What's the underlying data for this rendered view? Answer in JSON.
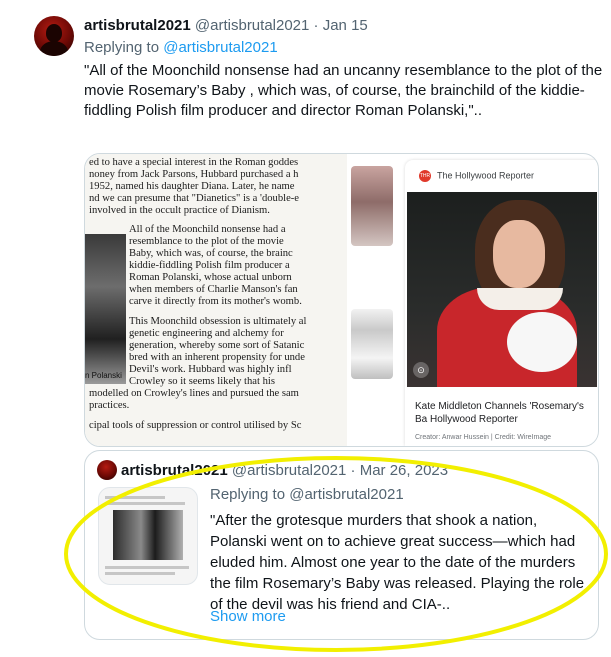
{
  "tweet": {
    "display_name": "artisbrutal2021",
    "handle": "@artisbrutal2021",
    "separator": "·",
    "date": "Jan 15",
    "replying_prefix": "Replying to",
    "replying_to": "@artisbrutal2021",
    "text": "\"All of the Moonchild nonsense had an uncanny resemblance to the plot of the movie Rosemary’s Baby , which was, of course, the brainchild of the kiddie-fiddling Polish film producer and director Roman Polanski,\".."
  },
  "media": {
    "scan_lines": [
      "ed to have a special interest in the Roman goddes",
      "noney from Jack Parsons, Hubbard purchased a h",
      "1952, named his daughter Diana. Later, he name",
      "nd we can presume that \"Dianetics\" is a 'double-e",
      "involved in the occult practice of Dianism.",
      "All of the Moonchild nonsense had a",
      "resemblance to the plot of the movie",
      "Baby, which was, of course, the brainc",
      "kiddie-fiddling Polish film producer a",
      "Roman Polanski, whose actual unborn",
      "when members of Charlie Manson's fan",
      "carve it directly from its mother's womb.",
      "This Moonchild obsession is ultimately al",
      "genetic engineering and alchemy for",
      "generation, whereby some sort of Satanic",
      "bred with an inherent propensity for unde",
      "Devil's work. Hubbard was highly infl",
      "Crowley so it seems likely that his",
      "modelled on Crowley's lines and pursued the sam",
      "practices.",
      "cipal tools of suppression or control utilised by Sc"
    ],
    "scan_caption": "n Polanski",
    "card_source": "The Hollywood Reporter",
    "card_logo": "THR",
    "card_title": "Kate Middleton Channels 'Rosemary's Ba Hollywood Reporter",
    "card_credit": "Creator: Anwar Hussein | Credit: WireImage",
    "card_lens_icon": "⊙"
  },
  "quote": {
    "display_name": "artisbrutal2021",
    "handle": "@artisbrutal2021",
    "separator": "·",
    "date": "Mar 26, 2023",
    "replying_line": "Replying to @artisbrutal2021",
    "text": "\"After the grotesque murders that shook a nation, Polanski went on to achieve great success—which had eluded him. Almost one year to the date of the murders the film Rosemary’s Baby was released. Playing the role of the devil was his friend and CIA-..",
    "show_more": "Show more"
  },
  "colors": {
    "link": "#1d9bf0",
    "muted": "#536471",
    "highlight_ellipse": "#f2ef00",
    "border": "#cfd9de"
  }
}
